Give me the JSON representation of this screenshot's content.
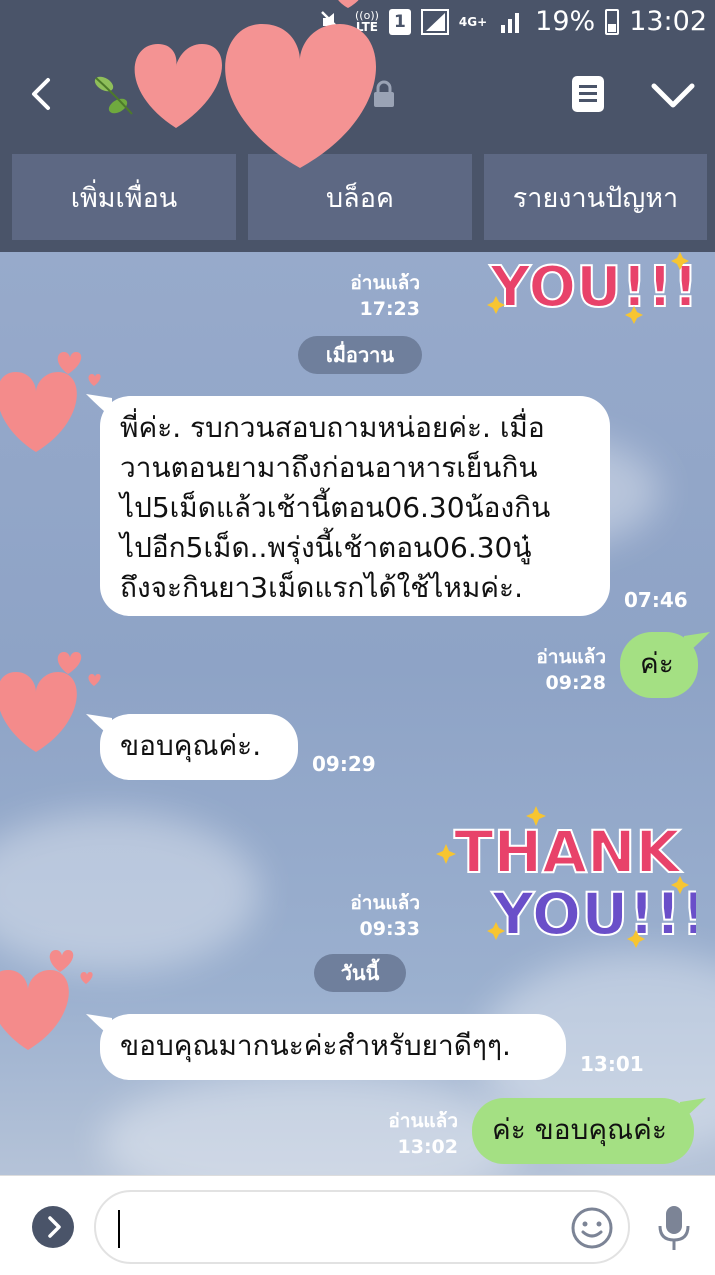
{
  "status_bar": {
    "lte_label": "LTE",
    "sim_number": "1",
    "network_type": "4G+",
    "battery": "19%",
    "time": "13:02"
  },
  "actions": {
    "add_friend": "เพิ่มเพื่อน",
    "block": "บล็อค",
    "report": "รายงานปัญหา"
  },
  "messages": {
    "m1": {
      "read": "อ่านแล้ว",
      "time": "17:23"
    },
    "date_yesterday": "เมื่อวาน",
    "m2": {
      "lines": [
        "พี่ค่ะ. รบกวนสอบถามหน่อยค่ะ. เมื่อ",
        "วานตอนยามาถึงก่อนอาหารเย็นกิน",
        "ไป5เม็ดแล้วเช้านี้ตอน06.30น้องกิน",
        "ไปอีก5เม็ด..พรุ่งนี้เช้าตอน06.30นู๋",
        "ถึงจะกินยา3เม็ดแรกได้ใช้ไหมค่ะ."
      ],
      "time": "07:46"
    },
    "m3": {
      "text": "ค่ะ",
      "read": "อ่านแล้ว",
      "time": "09:28"
    },
    "m4": {
      "text": "ขอบคุณค่ะ.",
      "time": "09:29"
    },
    "m5": {
      "read": "อ่านแล้ว",
      "time": "09:33"
    },
    "date_today": "วันนี้",
    "m6": {
      "text": "ขอบคุณมากนะค่ะสำหรับยาดีๆๆ.",
      "time": "13:01"
    },
    "m7": {
      "text": "ค่ะ ขอบคุณค่ะ",
      "read": "อ่านแล้ว",
      "time": "13:02"
    }
  },
  "stickers": {
    "line1": "THANK",
    "line2": "YOU!!!"
  },
  "icons": {
    "back": "chevron-left-icon",
    "lock": "lock-icon",
    "note": "note-icon",
    "menu": "chevron-down-icon",
    "expand": "chevron-right-icon",
    "emoji": "smiley-icon",
    "mic": "microphone-icon"
  },
  "colors": {
    "header_bg": "#4a5469",
    "button_bg": "#5d6883",
    "bubble_in": "#ffffff",
    "bubble_out": "#a4e083",
    "heart": "#f48b8b"
  }
}
